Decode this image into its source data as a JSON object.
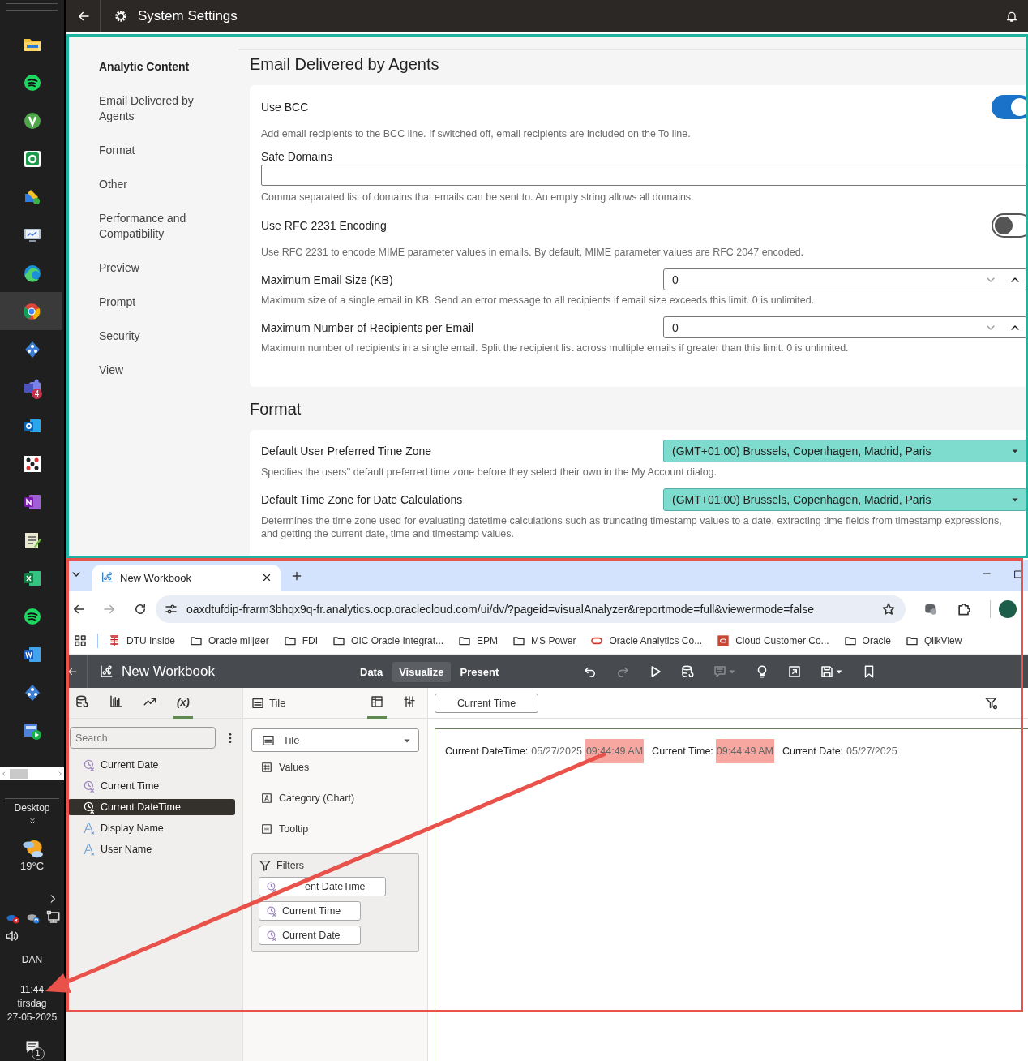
{
  "taskbar": {
    "apps": [
      {
        "kind": "folder",
        "selected": false
      },
      {
        "kind": "music",
        "selected": false
      },
      {
        "kind": "green-round",
        "selected": false
      },
      {
        "kind": "green-square",
        "selected": false
      },
      {
        "kind": "tool",
        "selected": false
      },
      {
        "kind": "monitor",
        "selected": false
      },
      {
        "kind": "edge",
        "selected": false
      },
      {
        "kind": "chrome",
        "selected": true
      },
      {
        "kind": "diamond",
        "selected": false
      },
      {
        "kind": "teams",
        "badge": "4",
        "selected": false
      },
      {
        "kind": "mail",
        "selected": false
      },
      {
        "kind": "dots",
        "selected": false
      },
      {
        "kind": "notebook",
        "selected": false
      },
      {
        "kind": "notepad",
        "selected": false
      },
      {
        "kind": "sheet",
        "selected": false
      },
      {
        "kind": "music",
        "selected": false
      },
      {
        "kind": "doc",
        "selected": false
      },
      {
        "kind": "diamond",
        "selected": false
      },
      {
        "kind": "media",
        "selected": false
      }
    ],
    "desktop_label": "Desktop",
    "temperature": "19°C",
    "language": "DAN",
    "time": "11:44",
    "day": "tirsdag",
    "date": "27-05-2025",
    "notification_count": "1"
  },
  "header": {
    "title": "System Settings"
  },
  "settings": {
    "framed": true,
    "sidebar": [
      {
        "label": "Analytic Content",
        "selected": true
      },
      {
        "label": "Email Delivered by Agents",
        "selected": false
      },
      {
        "label": "Format",
        "selected": false
      },
      {
        "label": "Other",
        "selected": false
      },
      {
        "label": "Performance and Compatibility",
        "selected": false
      },
      {
        "label": "Preview",
        "selected": false
      },
      {
        "label": "Prompt",
        "selected": false
      },
      {
        "label": "Security",
        "selected": false
      },
      {
        "label": "View",
        "selected": false
      }
    ],
    "sections": [
      {
        "title": "Email Delivered by Agents",
        "settings": [
          {
            "kind": "toggle",
            "label": "Use BCC",
            "on": true,
            "description": "Add email recipients to the BCC line. If switched off, email recipients are included on the To line."
          },
          {
            "kind": "text",
            "label": "Safe Domains",
            "description": "Comma separated list of domains that emails can be sent to. An empty string allows all domains."
          },
          {
            "kind": "toggle",
            "label": "Use RFC 2231 Encoding",
            "on": false,
            "description": "Use RFC 2231 to encode MIME parameter values in emails. By default, MIME parameter values are RFC 2047 encoded."
          },
          {
            "kind": "number",
            "label": "Maximum Email Size (KB)",
            "value": "0",
            "description": "Maximum size of a single email in KB. Send an error message to all recipients if email size exceeds this limit. 0 is unlimited."
          },
          {
            "kind": "number",
            "label": "Maximum Number of Recipients per Email",
            "value": "0",
            "description": "Maximum number of recipients in a single email. Split the recipient list across multiple emails if greater than this limit. 0 is unlimited."
          }
        ]
      },
      {
        "title": "Format",
        "settings": [
          {
            "kind": "select",
            "label": "Default User Preferred Time Zone",
            "value": "(GMT+01:00) Brussels, Copenhagen, Madrid, Paris",
            "highlighted": true,
            "description": "Specifies the users'' default preferred time zone before they select their own in the My Account dialog."
          },
          {
            "kind": "select",
            "label": "Default Time Zone for Date Calculations",
            "value": "(GMT+01:00) Brussels, Copenhagen, Madrid, Paris",
            "highlighted": true,
            "description": "Determines the time zone used for evaluating datetime calculations such as truncating timestamp values to a date, extracting time fields from timestamp expressions, and getting the current date, time and timestamp values."
          }
        ]
      }
    ]
  },
  "browser": {
    "framed": true,
    "arrow": true,
    "tabs": [
      {
        "title": "New Workbook",
        "selected": true
      }
    ],
    "nav": [
      {
        "kind": "back",
        "disabled": false
      },
      {
        "kind": "forward",
        "disabled": true
      },
      {
        "kind": "reload",
        "disabled": false
      }
    ],
    "address": "oaxdtufdip-frarm3bhqx9q-fr.analytics.ocp.oraclecloud.com/ui/dv/?pageid=visualAnalyzer&reportmode=full&viewermode=false",
    "bookmarks": [
      {
        "kind": "site",
        "label": "DTU Inside"
      },
      {
        "kind": "folder",
        "label": "Oracle miljøer"
      },
      {
        "kind": "folder",
        "label": "FDI"
      },
      {
        "kind": "folder",
        "label": "OIC Oracle Integrat..."
      },
      {
        "kind": "folder",
        "label": "EPM"
      },
      {
        "kind": "folder",
        "label": "MS Power"
      },
      {
        "kind": "oracle",
        "label": "Oracle Analytics Co..."
      },
      {
        "kind": "cloud",
        "label": "Cloud Customer Co..."
      },
      {
        "kind": "folder",
        "label": "Oracle"
      },
      {
        "kind": "folder",
        "label": "QlikView"
      }
    ]
  },
  "workbook": {
    "title": "New Workbook",
    "modes": [
      {
        "label": "Data",
        "selected": false
      },
      {
        "label": "Visualize",
        "selected": true
      },
      {
        "label": "Present",
        "selected": false
      }
    ],
    "tools": [
      {
        "kind": "undo",
        "disabled": false
      },
      {
        "kind": "redo",
        "disabled": true
      },
      {
        "kind": "play",
        "disabled": false
      },
      {
        "kind": "data",
        "disabled": false
      },
      {
        "kind": "comment",
        "disabled": true,
        "caret": true
      },
      {
        "kind": "bulb",
        "disabled": false
      },
      {
        "kind": "export",
        "disabled": false
      },
      {
        "kind": "save",
        "disabled": false,
        "caret": true
      },
      {
        "kind": "bookmark",
        "disabled": false
      }
    ],
    "data_panel": {
      "tabs": [
        {
          "kind": "data",
          "selected": false
        },
        {
          "kind": "chart",
          "selected": false
        },
        {
          "kind": "trend",
          "selected": false
        },
        {
          "kind": "text",
          "label": "(x)",
          "selected": true
        }
      ],
      "search": {
        "placeholder": "Search"
      },
      "items": [
        {
          "kind": "clock",
          "label": "Current Date",
          "selected": false
        },
        {
          "kind": "clock",
          "label": "Current Time",
          "selected": false
        },
        {
          "kind": "clock",
          "label": "Current DateTime",
          "selected": true
        },
        {
          "kind": "text",
          "label": "Display Name",
          "selected": false
        },
        {
          "kind": "text",
          "label": "User Name",
          "selected": false
        }
      ]
    },
    "grammar_panel": {
      "title": "Tile",
      "tabs": [
        {
          "kind": "layout",
          "selected": true
        },
        {
          "kind": "sliders",
          "selected": false
        }
      ],
      "viz_type": "Tile",
      "rows": [
        {
          "kind": "values",
          "label": "Values"
        },
        {
          "kind": "category",
          "label": "Category (Chart)"
        },
        {
          "kind": "tooltip",
          "label": "Tooltip"
        }
      ],
      "filters": {
        "title": "Filters",
        "chips": [
          {
            "label": "ent DateTime",
            "partly_covered": true
          },
          {
            "label": "Current Time",
            "partly_covered": false
          },
          {
            "label": "Current Date",
            "partly_covered": false
          }
        ]
      }
    },
    "canvas": {
      "tabs": [
        {
          "label": "Current Time",
          "selected": true
        }
      ],
      "fields": [
        {
          "label": "Current DateTime:",
          "parts": [
            {
              "text": "05/27/2025",
              "highlighted": false
            },
            {
              "text": "09:44:49 AM",
              "highlighted": true
            }
          ]
        },
        {
          "label": "Current Time:",
          "parts": [
            {
              "text": "09:44:49 AM",
              "highlighted": true
            }
          ]
        },
        {
          "label": "Current Date:",
          "parts": [
            {
              "text": "05/27/2025",
              "highlighted": false
            }
          ]
        }
      ]
    }
  }
}
